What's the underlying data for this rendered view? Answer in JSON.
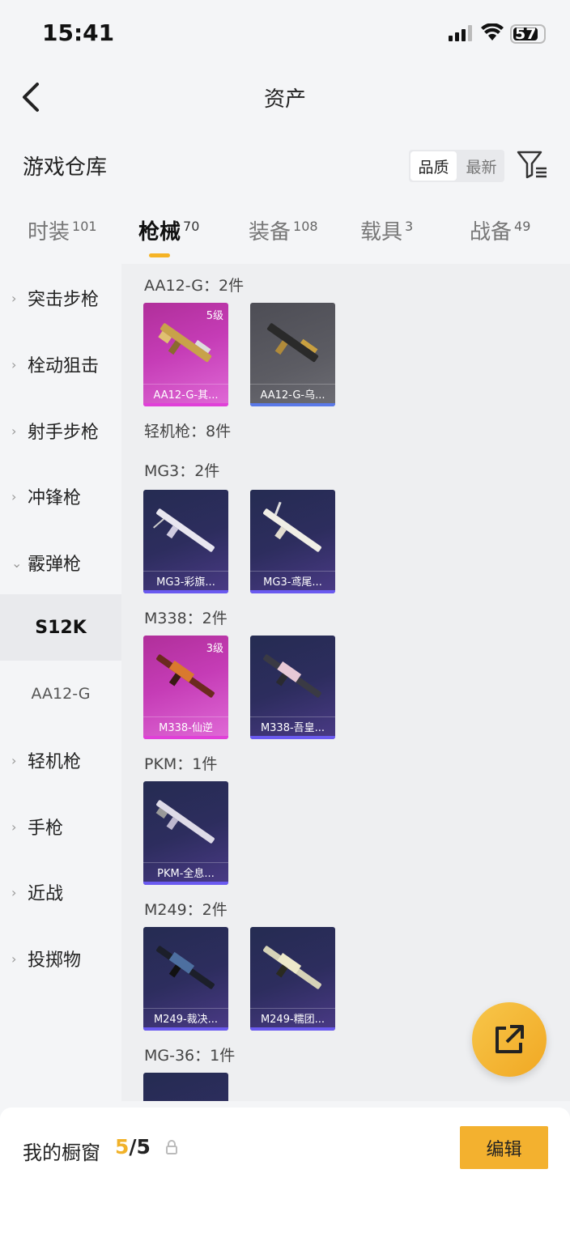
{
  "status_bar": {
    "time": "15:41",
    "battery": "57"
  },
  "header": {
    "title": "资产"
  },
  "section": {
    "title": "游戏仓库"
  },
  "sort": {
    "quality": "品质",
    "newest": "最新"
  },
  "tabs": [
    {
      "label": "时装",
      "count": "101"
    },
    {
      "label": "枪械",
      "count": "70"
    },
    {
      "label": "装备",
      "count": "108"
    },
    {
      "label": "载具",
      "count": "3"
    },
    {
      "label": "战备",
      "count": "49"
    }
  ],
  "sidebar": {
    "items": [
      {
        "label": "突击步枪"
      },
      {
        "label": "栓动狙击"
      },
      {
        "label": "射手步枪"
      },
      {
        "label": "冲锋枪"
      },
      {
        "label": "霰弹枪"
      }
    ],
    "sub_items": [
      {
        "label": "S12K"
      },
      {
        "label": "AA12-G"
      }
    ],
    "items_after": [
      {
        "label": "轻机枪"
      },
      {
        "label": "手枪"
      },
      {
        "label": "近战"
      },
      {
        "label": "投掷物"
      }
    ]
  },
  "groups": [
    {
      "title": "AA12-G：2件"
    },
    {
      "title": "轻机枪：8件"
    },
    {
      "title": "MG3：2件"
    },
    {
      "title": "M338：2件"
    },
    {
      "title": "PKM：1件"
    },
    {
      "title": "M249：2件"
    },
    {
      "title": "MG-36：1件"
    }
  ],
  "cards": [
    {
      "name": "AA12-G-其...",
      "level": "5级",
      "rarity": "pink"
    },
    {
      "name": "AA12-G-乌...",
      "level": "",
      "rarity": "grey"
    },
    {
      "name": "MG3-彩旗...",
      "level": "",
      "rarity": "purple"
    },
    {
      "name": "MG3-鸢尾...",
      "level": "",
      "rarity": "purple"
    },
    {
      "name": "M338-仙逆",
      "level": "3级",
      "rarity": "pink"
    },
    {
      "name": "M338-吾皇...",
      "level": "",
      "rarity": "purple"
    },
    {
      "name": "PKM-全息...",
      "level": "",
      "rarity": "purple"
    },
    {
      "name": "M249-裁决...",
      "level": "",
      "rarity": "purple"
    },
    {
      "name": "M249-糯团...",
      "level": "",
      "rarity": "purple"
    },
    {
      "name": "",
      "level": "",
      "rarity": "purple"
    }
  ],
  "bottom": {
    "label": "我的橱窗",
    "count_current": "5",
    "count_total": "/5",
    "edit": "编辑"
  },
  "icons": {
    "back": "chevron-left-icon",
    "filter": "filter-icon",
    "share": "share-external-icon",
    "lock": "lock-icon"
  },
  "colors": {
    "accent": "#f3b12f",
    "rarity_pink": "#c53cb6",
    "rarity_purple": "#2d2d5e",
    "rarity_grey": "#5c5c63"
  }
}
